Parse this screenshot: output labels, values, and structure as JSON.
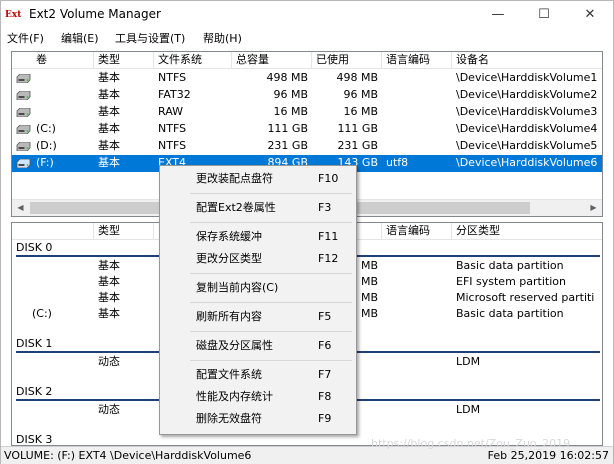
{
  "window": {
    "title": "Ext2 Volume Manager",
    "app_icon_text": "Ext"
  },
  "menu": [
    "文件(F)",
    "编辑(E)",
    "工具与设置(T)",
    "帮助(H)"
  ],
  "volume_table": {
    "headers": [
      "卷",
      "类型",
      "文件系统",
      "总容量",
      "已使用",
      "语言编码",
      "设备名"
    ],
    "rows": [
      {
        "vol": "",
        "type": "基本",
        "fs": "NTFS",
        "total": "498 MB",
        "used": "498 MB",
        "codepage": "",
        "device": "\\Device\\HarddiskVolume1",
        "selected": false
      },
      {
        "vol": "",
        "type": "基本",
        "fs": "FAT32",
        "total": "96 MB",
        "used": "96 MB",
        "codepage": "",
        "device": "\\Device\\HarddiskVolume2",
        "selected": false
      },
      {
        "vol": "",
        "type": "基本",
        "fs": "RAW",
        "total": "16 MB",
        "used": "16 MB",
        "codepage": "",
        "device": "\\Device\\HarddiskVolume3",
        "selected": false
      },
      {
        "vol": "(C:)",
        "type": "基本",
        "fs": "NTFS",
        "total": "111 GB",
        "used": "111 GB",
        "codepage": "",
        "device": "\\Device\\HarddiskVolume4",
        "selected": false
      },
      {
        "vol": "(D:)",
        "type": "基本",
        "fs": "NTFS",
        "total": "231 GB",
        "used": "231 GB",
        "codepage": "",
        "device": "\\Device\\HarddiskVolume5",
        "selected": false
      },
      {
        "vol": "(F:)",
        "type": "基本",
        "fs": "EXT4",
        "total": "894 GB",
        "used": "143 GB",
        "codepage": "utf8",
        "device": "\\Device\\HarddiskVolume6",
        "selected": true
      }
    ]
  },
  "disk_table": {
    "headers": [
      "",
      "类型",
      "",
      "",
      "已使用",
      "语言编码",
      "分区类型"
    ],
    "disks": [
      {
        "name": "DISK 0",
        "parts": [
          {
            "vol": "",
            "type": "基本",
            "fs": "N",
            "used": "3 MB",
            "ptype": "Basic data partition"
          },
          {
            "vol": "",
            "type": "基本",
            "fs": "F",
            "used": "3 MB",
            "ptype": "EFI system partition"
          },
          {
            "vol": "",
            "type": "基本",
            "fs": "F",
            "used": "3 MB",
            "ptype": "Microsoft reserved partiti"
          },
          {
            "vol": "(C:)",
            "type": "基本",
            "fs": "N",
            "used": "3 MB",
            "ptype": "Basic data partition"
          }
        ]
      },
      {
        "name": "DISK 1",
        "parts": [
          {
            "vol": "",
            "type": "动态",
            "fs": "",
            "used": "",
            "ptype": "LDM"
          }
        ]
      },
      {
        "name": "DISK 2",
        "parts": [
          {
            "vol": "",
            "type": "动态",
            "fs": "",
            "used": "",
            "ptype": "LDM"
          }
        ]
      },
      {
        "name": "DISK 3",
        "parts": []
      }
    ]
  },
  "context_menu": {
    "items": [
      {
        "label": "更改装配点盘符",
        "key": "F10"
      },
      {
        "sep": true
      },
      {
        "label": "配置Ext2卷属性",
        "key": "F3"
      },
      {
        "sep": true
      },
      {
        "label": "保存系统缓冲",
        "key": "F11"
      },
      {
        "label": "更改分区类型",
        "key": "F12"
      },
      {
        "sep": true
      },
      {
        "label": "复制当前内容(C)",
        "key": ""
      },
      {
        "sep": true
      },
      {
        "label": "刷新所有内容",
        "key": "F5"
      },
      {
        "sep": true
      },
      {
        "label": "磁盘及分区属性",
        "key": "F6"
      },
      {
        "sep": true
      },
      {
        "label": "配置文件系统",
        "key": "F7"
      },
      {
        "label": "性能及内存统计",
        "key": "F8"
      },
      {
        "label": "删除无效盘符",
        "key": "F9"
      }
    ]
  },
  "status": {
    "left": "VOLUME: (F:) EXT4 \\Device\\HarddiskVolume6",
    "right": "Feb 25,2019 16:02:57",
    "watermark": "https://blog.csdn.net/Zou_Zuo_2019"
  },
  "icons": {
    "volume_disk": "drive-icon",
    "minimize": "minimize-icon",
    "maximize": "maximize-icon",
    "close": "close-icon"
  },
  "colors": {
    "selection": "#0078d7",
    "disk_line": "#20407a",
    "app_icon": "#c00000"
  }
}
